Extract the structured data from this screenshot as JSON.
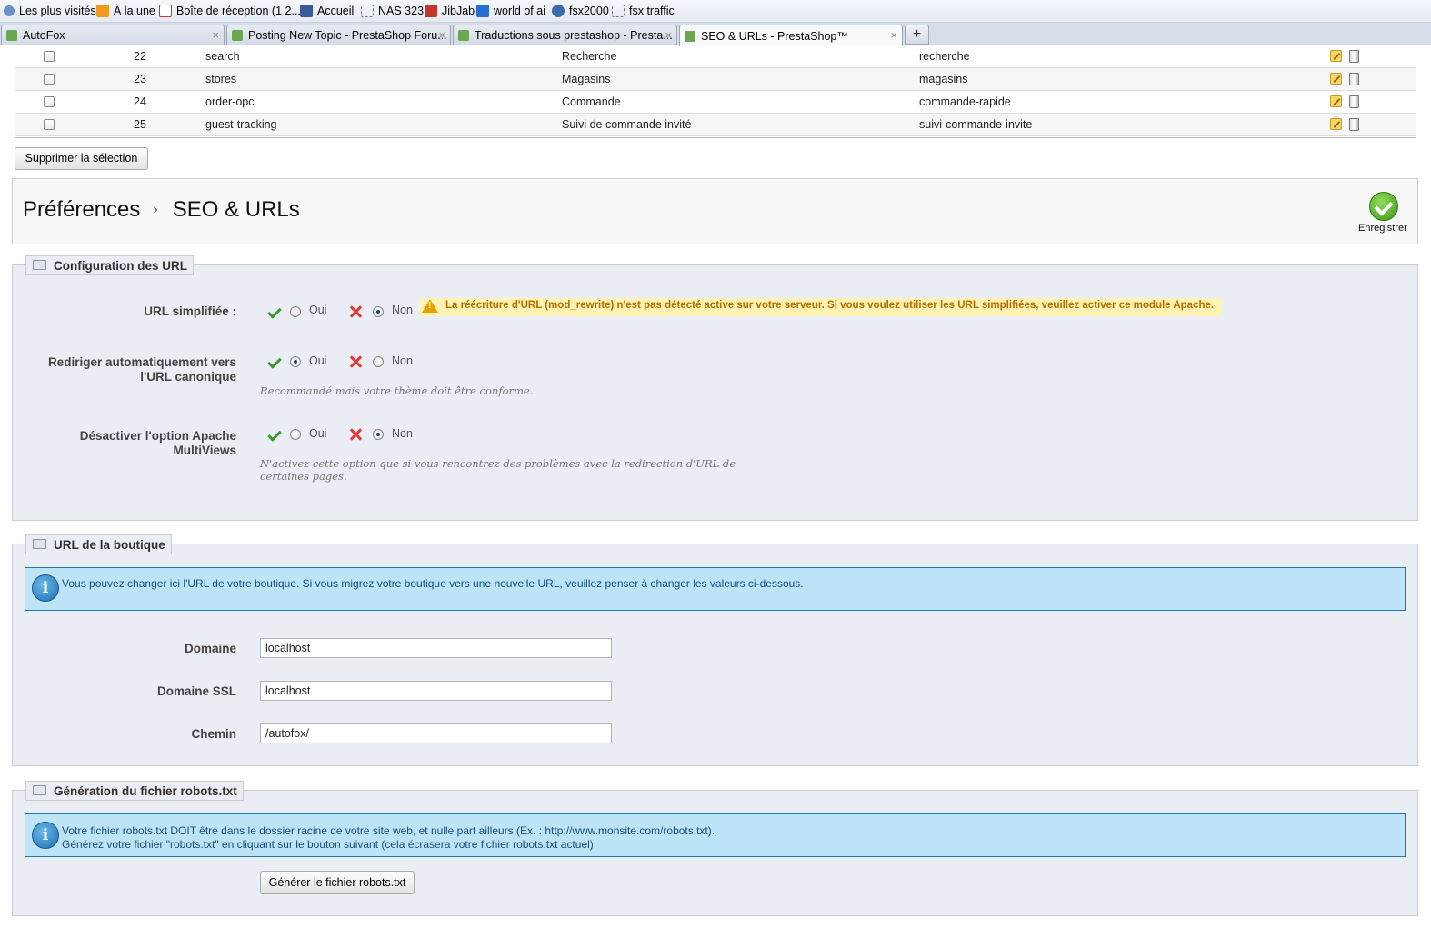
{
  "bookmarks": [
    {
      "label": "Les plus visités",
      "icon": "most-visited-icon"
    },
    {
      "label": "À la une",
      "icon": "rss-icon"
    },
    {
      "label": "Boîte de réception (1 2...",
      "icon": "gmail-icon"
    },
    {
      "label": "Accueil",
      "icon": "facebook-icon"
    },
    {
      "label": "NAS 323",
      "icon": "blank-page-icon"
    },
    {
      "label": "JibJab",
      "icon": "jibjab-icon"
    },
    {
      "label": "world of ai",
      "icon": "flag-icon"
    },
    {
      "label": "fsx2000",
      "icon": "fsx-icon"
    },
    {
      "label": "fsx traffic",
      "icon": "blank-page-icon"
    }
  ],
  "tabs": [
    {
      "label": "AutoFox"
    },
    {
      "label": "Posting New Topic - PrestaShop Foru..."
    },
    {
      "label": "Traductions sous prestashop - Presta..."
    },
    {
      "label": "SEO & URLs - PrestaShop™"
    }
  ],
  "new_tab_symbol": "+",
  "close_symbol": "×",
  "table": {
    "rows": [
      {
        "id": "22",
        "page": "search",
        "title": "Recherche",
        "rewrite": "recherche"
      },
      {
        "id": "23",
        "page": "stores",
        "title": "Magasins",
        "rewrite": "magasins"
      },
      {
        "id": "24",
        "page": "order-opc",
        "title": "Commande",
        "rewrite": "commande-rapide"
      },
      {
        "id": "25",
        "page": "guest-tracking",
        "title": "Suivi de commande invité",
        "rewrite": "suivi-commande-invite"
      }
    ],
    "delete_selection": "Supprimer la sélection"
  },
  "header": {
    "breadcrumb_parent": "Préférences",
    "breadcrumb_sep": "›",
    "breadcrumb_current": "SEO & URLs",
    "save_label": "Enregistrer"
  },
  "url_config": {
    "legend": "Configuration des URL",
    "yes": "Oui",
    "no": "Non",
    "friendly_url": {
      "label": "URL simplifiée :",
      "value": "Non",
      "warning": "La réécriture d'URL (mod_rewrite) n'est pas détecté active sur votre serveur. Si vous voulez utiliser les URL simplifiées, veuillez activer ce module Apache."
    },
    "canonical": {
      "label_line1": "Rediriger automatiquement vers",
      "label_line2": "l'URL canonique",
      "value": "Oui",
      "hint": "Recommandé mais votre thème doit être conforme."
    },
    "multiviews": {
      "label_line1": "Désactiver l'option Apache",
      "label_line2": "MultiViews",
      "value": "Non",
      "hint_line1": "N'activez cette option que si vous rencontrez des problèmes avec la redirection d'URL de",
      "hint_line2": "certaines pages."
    }
  },
  "shop_url": {
    "legend": "URL de la boutique",
    "info": "Vous pouvez changer ici l'URL de votre boutique. Si vous migrez votre boutique vers une nouvelle URL, veuillez penser à changer les valeurs ci-dessous.",
    "domain_label": "Domaine",
    "domain_value": "localhost",
    "ssl_label": "Domaine SSL",
    "ssl_value": "localhost",
    "path_label": "Chemin",
    "path_value": "/autofox/"
  },
  "robots": {
    "legend": "Génération du fichier robots.txt",
    "info_line1": "Votre fichier robots.txt DOIT être dans le dossier racine de votre site web, et nulle part ailleurs (Ex. : http://www.monsite.com/robots.txt).",
    "info_line2": "Générez votre fichier \"robots.txt\" en cliquant sur le bouton suivant (cela écrasera votre fichier robots.txt actuel)",
    "button": "Générer le fichier robots.txt"
  },
  "info_icon_letter": "i",
  "colors": {
    "info_bg": "#bce4f6",
    "info_border": "#1b7aa8",
    "warning_bg": "#fff2b3",
    "warning_text": "#b46e00",
    "fieldset_bg": "#ebedf4",
    "yes_green": "#3a9a2c",
    "no_red": "#e03a3a"
  }
}
